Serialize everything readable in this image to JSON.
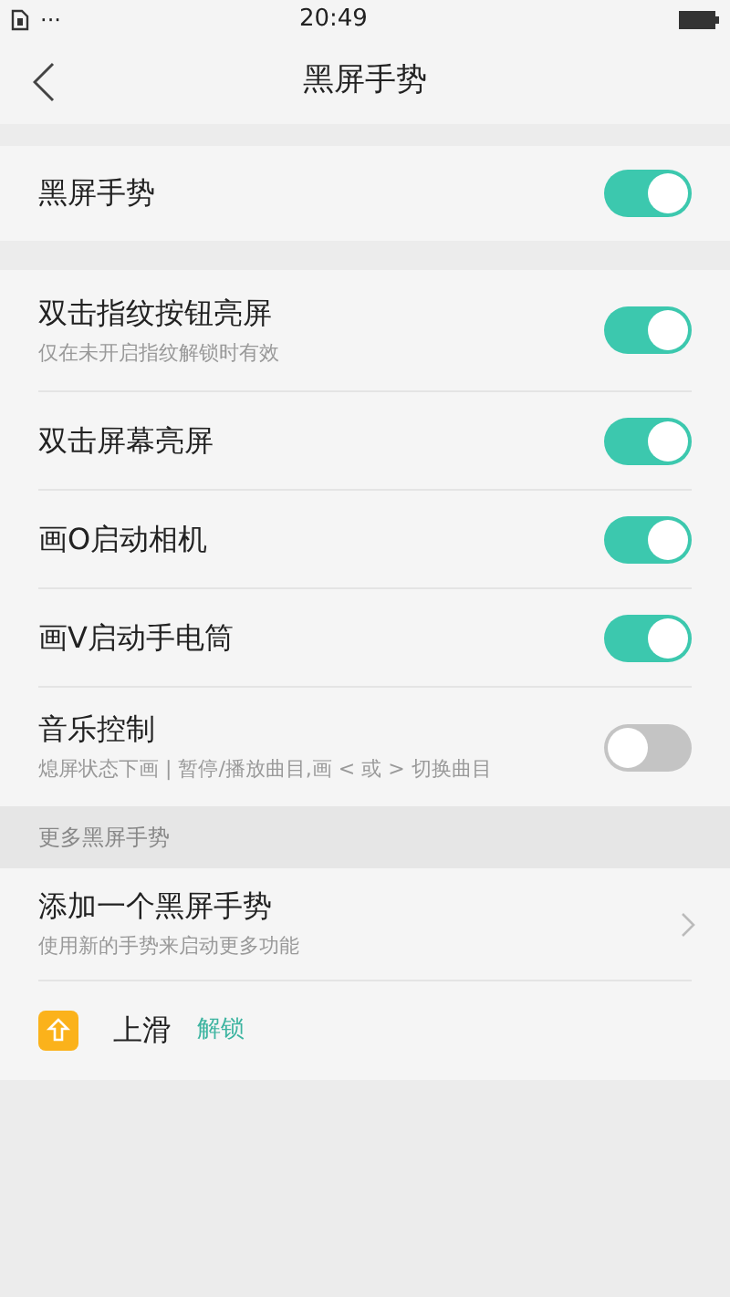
{
  "status_bar": {
    "dots": "···",
    "time": "20:49"
  },
  "header": {
    "title": "黑屏手势"
  },
  "master": {
    "label": "黑屏手势",
    "on": true
  },
  "toggles": [
    {
      "label": "双击指纹按钮亮屏",
      "sublabel": "仅在未开启指纹解锁时有效",
      "on": true
    },
    {
      "label": "双击屏幕亮屏",
      "on": true
    },
    {
      "label": "画O启动相机",
      "on": true
    },
    {
      "label": "画V启动手电筒",
      "on": true
    },
    {
      "label": "音乐控制",
      "sublabel": "熄屏状态下画 | 暂停/播放曲目,画 < 或 > 切换曲目",
      "on": false
    }
  ],
  "section_header": "更多黑屏手势",
  "add_item": {
    "title": "添加一个黑屏手势",
    "subtitle": "使用新的手势来启动更多功能"
  },
  "gestures": [
    {
      "name": "上滑",
      "action": "解锁"
    }
  ]
}
